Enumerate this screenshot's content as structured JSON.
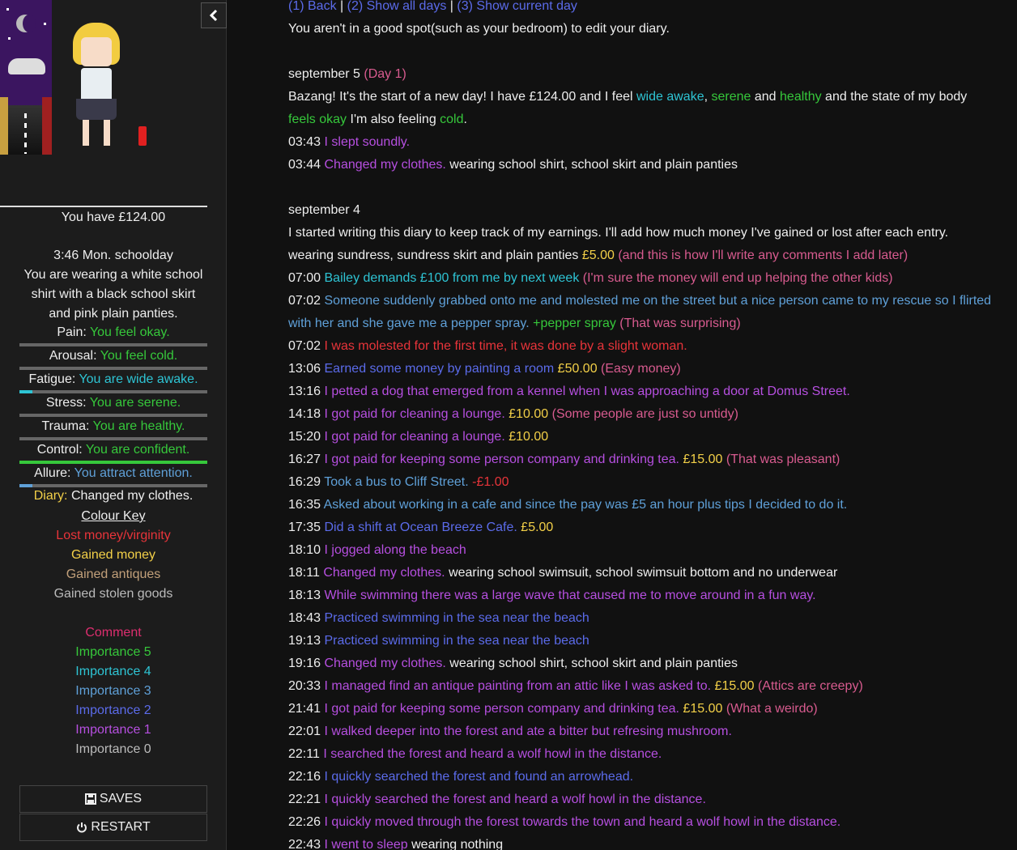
{
  "sidebar": {
    "money": "You have £124.00",
    "time": "3:46 Mon. schoolday",
    "wearing": "You are wearing a white school shirt with a black school skirt and pink plain panties.",
    "stats": [
      {
        "label": "Pain:",
        "value": "You feel okay.",
        "color": "#36c83b",
        "bar_fill": 0.0,
        "bar_color": "#36c83b"
      },
      {
        "label": "Arousal:",
        "value": "You feel cold.",
        "color": "#36c83b",
        "bar_fill": 0.0,
        "bar_color": "#36c83b"
      },
      {
        "label": "Fatigue:",
        "value": "You are wide awake.",
        "color": "#2ec4d4",
        "bar_fill": 0.07,
        "bar_color": "#2ec4d4"
      },
      {
        "label": "Stress:",
        "value": "You are serene.",
        "color": "#36c83b",
        "bar_fill": 0.0,
        "bar_color": "#36c83b"
      },
      {
        "label": "Trauma:",
        "value": "You are healthy.",
        "color": "#36c83b",
        "bar_fill": 0.0,
        "bar_color": "#36c83b"
      },
      {
        "label": "Control:",
        "value": "You are confident.",
        "color": "#36c83b",
        "bar_fill": 1.0,
        "bar_color": "#36c83b"
      },
      {
        "label": "Allure:",
        "value": "You attract attention.",
        "color": "#5fa0d8",
        "bar_fill": 0.07,
        "bar_color": "#5fa0d8"
      }
    ],
    "diary_label": "Diary:",
    "diary_value": "Changed my clothes.",
    "colour_key_title": "Colour Key",
    "key_items": [
      {
        "text": "Lost money/virginity",
        "color": "#e8343a"
      },
      {
        "text": "Gained money",
        "color": "#f3d048"
      },
      {
        "text": "Gained antiques",
        "color": "#c2a07a"
      },
      {
        "text": "Gained stolen goods",
        "color": "#bbbbbb"
      }
    ],
    "importance_items": [
      {
        "text": "Comment",
        "color": "#dd2e6f"
      },
      {
        "text": "Importance 5",
        "color": "#36c83b"
      },
      {
        "text": "Importance 4",
        "color": "#2ec4d4"
      },
      {
        "text": "Importance 3",
        "color": "#5fa0d8"
      },
      {
        "text": "Importance 2",
        "color": "#5b6bea"
      },
      {
        "text": "Importance 1",
        "color": "#b64fe0"
      },
      {
        "text": "Importance 0",
        "color": "#bbbbbb"
      }
    ],
    "saves_label": "SAVES",
    "restart_label": "RESTART"
  },
  "main": {
    "nav": {
      "back": "(1) Back",
      "sep1": " | ",
      "show_all": "(2) Show all days",
      "sep2": " | ",
      "show_current": "(3) Show current day"
    },
    "notice": "You aren't in a good spot(such as your bedroom) to edit your diary.",
    "day1": {
      "heading": "september 5",
      "day_tag": "(Day 1)",
      "intro_a": "Bazang! It's the start of a new day! I have £124.00 and I feel ",
      "wide_awake": "wide awake",
      "comma": ", ",
      "serene": "serene",
      "and1": " and ",
      "healthy": "healthy",
      "intro_b": " and the state of my body",
      "feels_okay": "feels okay",
      "intro_c": " I'm also feeling ",
      "cold": "cold",
      "period": ".",
      "entries": [
        {
          "time": "03:43",
          "text": "I slept soundly.",
          "color": "#b64fe0",
          "extra": ""
        },
        {
          "time": "03:44",
          "text": "Changed my clothes.",
          "color": "#b64fe0",
          "extra": " wearing school shirt, school skirt and plain panties"
        }
      ]
    },
    "day0": {
      "heading": "september 4",
      "line1": "I started writing this diary to keep track of my earnings. I'll add how much money I've gained or lost after each entry.",
      "line2_a": "wearing sundress, sundress skirt and plain panties ",
      "line2_money": "£5.00",
      "line2_comment": " (and this is how I'll write any comments I add later)",
      "entries": [
        {
          "time": "07:00",
          "text": "Bailey demands £100 from me by next week",
          "color": "#2ec4d4",
          "money": "",
          "money_color": "",
          "comment": " (I'm sure the money will end up helping the other kids)"
        },
        {
          "time": "07:02",
          "text": "Someone suddenly grabbed onto me and molested me on the street but a nice person came to my rescue so I flirted with her and she gave me a pepper spray.",
          "color": "#5fa0d8",
          "money": " +pepper spray",
          "money_color": "#36c83b",
          "comment": " (That was surprising)"
        },
        {
          "time": "07:02",
          "text": "I was molested for the first time, it was done by a slight woman.",
          "color": "#e8343a",
          "money": "",
          "money_color": "",
          "comment": ""
        },
        {
          "time": "13:06",
          "text": "Earned some money by painting a room",
          "color": "#5b6bea",
          "money": " £50.00",
          "money_color": "#f3d048",
          "comment": " (Easy money)"
        },
        {
          "time": "13:16",
          "text": "I petted a dog that emerged from a kennel when I was approaching a door at Domus Street.",
          "color": "#b64fe0",
          "money": "",
          "money_color": "",
          "comment": ""
        },
        {
          "time": "14:18",
          "text": "I got paid for cleaning a lounge.",
          "color": "#b64fe0",
          "money": " £10.00",
          "money_color": "#f3d048",
          "comment": " (Some people are just so untidy)"
        },
        {
          "time": "15:20",
          "text": "I got paid for cleaning a lounge.",
          "color": "#b64fe0",
          "money": " £10.00",
          "money_color": "#f3d048",
          "comment": ""
        },
        {
          "time": "16:27",
          "text": "I got paid for keeping some person company and drinking tea.",
          "color": "#b64fe0",
          "money": " £15.00",
          "money_color": "#f3d048",
          "comment": " (That was pleasant)"
        },
        {
          "time": "16:29",
          "text": "Took a bus to Cliff Street.",
          "color": "#5fa0d8",
          "money": " -£1.00",
          "money_color": "#e8343a",
          "comment": ""
        },
        {
          "time": "16:35",
          "text": "Asked about working in a cafe and since the pay was £5 an hour plus tips I decided to do it.",
          "color": "#5fa0d8",
          "money": "",
          "money_color": "",
          "comment": ""
        },
        {
          "time": "17:35",
          "text": "Did a shift at Ocean Breeze Cafe.",
          "color": "#5b6bea",
          "money": " £5.00",
          "money_color": "#f3d048",
          "comment": ""
        },
        {
          "time": "18:10",
          "text": "I jogged along the beach",
          "color": "#b64fe0",
          "money": "",
          "money_color": "",
          "comment": ""
        },
        {
          "time": "18:11",
          "text": "Changed my clothes.",
          "color": "#b64fe0",
          "money": " wearing school swimsuit, school swimsuit bottom and no underwear",
          "money_color": "#eeeeee",
          "comment": ""
        },
        {
          "time": "18:13",
          "text": "While swimming there was a large wave that caused me to move around in a fun way.",
          "color": "#b64fe0",
          "money": "",
          "money_color": "",
          "comment": ""
        },
        {
          "time": "18:43",
          "text": "Practiced swimming in the sea near the beach",
          "color": "#5b6bea",
          "money": "",
          "money_color": "",
          "comment": ""
        },
        {
          "time": "19:13",
          "text": "Practiced swimming in the sea near the beach",
          "color": "#5b6bea",
          "money": "",
          "money_color": "",
          "comment": ""
        },
        {
          "time": "19:16",
          "text": "Changed my clothes.",
          "color": "#b64fe0",
          "money": " wearing school shirt, school skirt and plain panties",
          "money_color": "#eeeeee",
          "comment": ""
        },
        {
          "time": "20:33",
          "text": "I managed find an antique painting from an attic like I was asked to.",
          "color": "#b64fe0",
          "money": " £15.00",
          "money_color": "#f3d048",
          "comment": " (Attics are creepy)"
        },
        {
          "time": "21:41",
          "text": "I got paid for keeping some person company and drinking tea.",
          "color": "#b64fe0",
          "money": " £15.00",
          "money_color": "#f3d048",
          "comment": " (What a weirdo)"
        },
        {
          "time": "22:01",
          "text": "I walked deeper into the forest and ate a bitter but refresing mushroom.",
          "color": "#b64fe0",
          "money": "",
          "money_color": "",
          "comment": ""
        },
        {
          "time": "22:11",
          "text": "I searched the forest and heard a wolf howl in the distance.",
          "color": "#b64fe0",
          "money": "",
          "money_color": "",
          "comment": ""
        },
        {
          "time": "22:16",
          "text": "I quickly searched the forest and found an arrowhead.",
          "color": "#5b6bea",
          "money": "",
          "money_color": "",
          "comment": ""
        },
        {
          "time": "22:21",
          "text": "I quickly searched the forest and heard a wolf howl in the distance.",
          "color": "#b64fe0",
          "money": "",
          "money_color": "",
          "comment": ""
        },
        {
          "time": "22:26",
          "text": "I quickly moved through the forest towards the town and heard a wolf howl in the distance.",
          "color": "#b64fe0",
          "money": "",
          "money_color": "",
          "comment": ""
        },
        {
          "time": "22:43",
          "text": "I went to sleep",
          "color": "#b64fe0",
          "money": " wearing nothing",
          "money_color": "#eeeeee",
          "comment": ""
        }
      ]
    }
  },
  "colors": {
    "comment": "#d85b8f",
    "importance5": "#36c83b",
    "importance4": "#2ec4d4",
    "link": "#5b6bea",
    "day_tag": "#d85b8f",
    "money": "#f3d048"
  }
}
